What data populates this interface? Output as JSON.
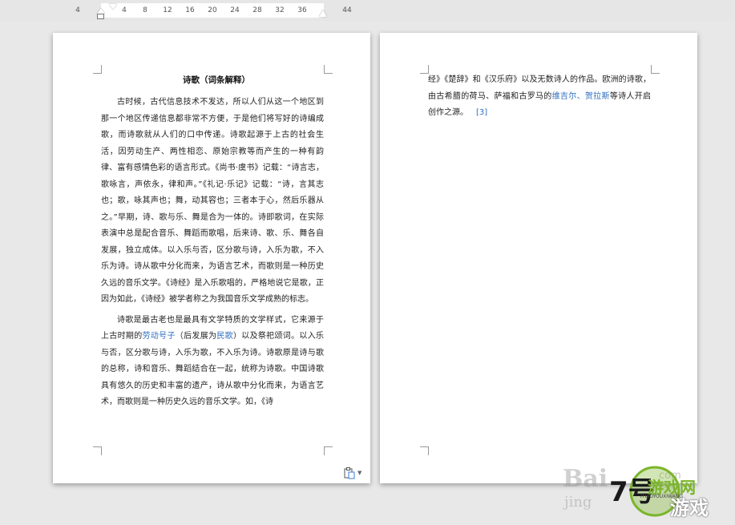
{
  "ruler": {
    "ticks": [
      "4",
      "4",
      "8",
      "12",
      "16",
      "20",
      "24",
      "28",
      "32",
      "36",
      "44"
    ]
  },
  "page1": {
    "title": "诗歌（词条解释）",
    "para1": "古时候，古代信息技术不发达，所以人们从这一个地区到那一个地区传递信息都非常不方便，于是他们将写好的诗编成歌，而诗歌就从人们的口中传递。诗歌起源于上古的社会生活，因劳动生产、两性相恋、原始宗教等而产生的一种有韵律、富有感情色彩的语言形式。《尚书·虞书》记载：“诗言志，歌咏言，声依永，律和声。”《礼记·乐记》记载：“诗，言其志也；歌，咏其声也；舞，动其容也；三者本于心，然后乐器从之。”早期，诗、歌与乐、舞是合为一体的。诗即歌词，在实际表演中总是配合音乐、舞蹈而歌唱，后来诗、歌、乐、舞各自发展，独立成体。以入乐与否，区分歌与诗，入乐为歌，不入乐为诗。诗从歌中分化而来，为语言艺术，而歌则是一种历史久远的音乐文学。《诗经》是入乐歌唱的，严格地说它是歌，正因为如此，《诗经》被学者称之为我国音乐文学成熟的标志。",
    "para2_a": "诗歌是最古老也是最具有文学特质的文学样式，它来源于上古时期的",
    "para2_link1": "劳动号子",
    "para2_b": "（后发展为",
    "para2_link2": "民歌",
    "para2_c": "）以及祭祀颂词。以入乐与否，区分歌与诗，入乐为歌，不入乐为诗。诗歌原是诗与歌的总称，诗和音乐、舞蹈结合在一起，统称为诗歌。中国诗歌具有悠久的历史和丰富的遗产，诗从歌中分化而来，为语言艺术，而歌则是一种历史久远的音乐文学。如，《诗"
  },
  "page2": {
    "text_a": "经》《楚辞》和《汉乐府》以及无数诗人的作品。欧洲的诗歌，由古希腊的荷马、萨福和古罗马的",
    "link1": "维吉尔",
    "sep": "、",
    "link2": "贺拉斯",
    "text_b": "等诗人开启创作之源。",
    "citation": "[3]"
  },
  "watermark": {
    "baidu": "Bai",
    "jingyan": "jing",
    "url": "com",
    "logo_num": "7号",
    "logo_text1": "游戏网",
    "logo_text2": "游戏",
    "logo_en": "7HAOYOUXIWANG"
  },
  "colors": {
    "link": "#2e6fbf",
    "logo_green": "#7ab52a"
  },
  "icons": {
    "paste_options": "clipboard-icon"
  }
}
